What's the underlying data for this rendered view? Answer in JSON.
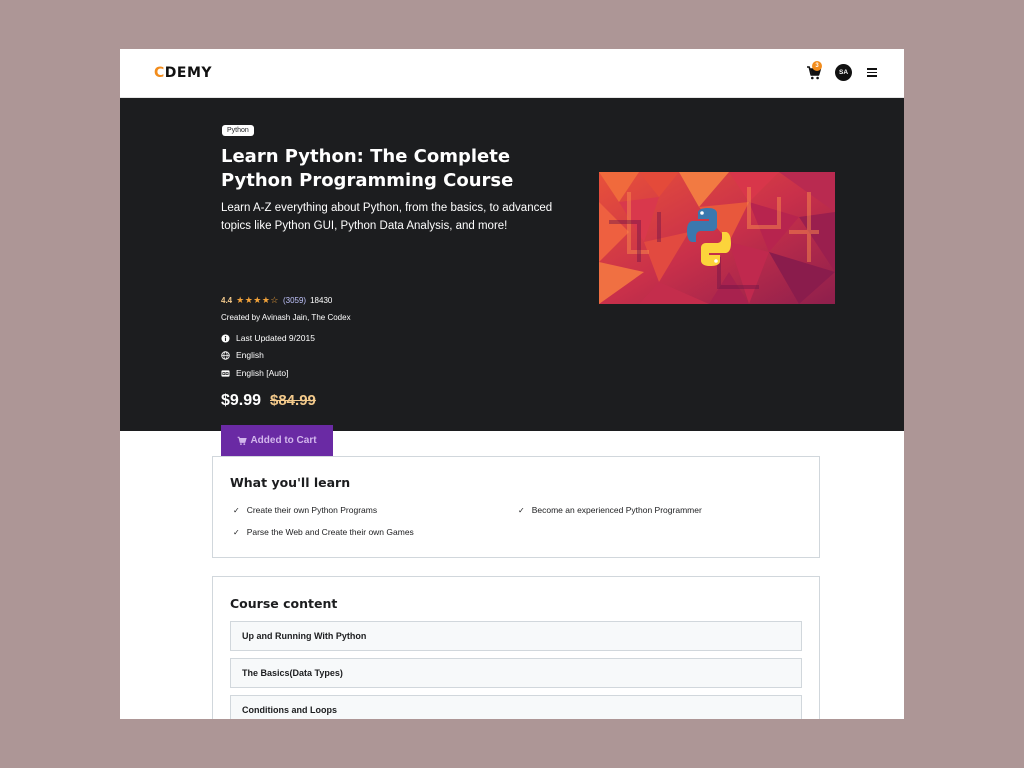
{
  "header": {
    "logo_first": "C",
    "logo_rest": "DEMY",
    "cart_count": "3",
    "avatar_initials": "SA"
  },
  "hero": {
    "tag": "Python",
    "title": "Learn Python: The Complete Python Programming Course",
    "subtitle": "Learn A-Z everything about Python, from the basics, to advanced topics like Python GUI, Python Data Analysis, and more!",
    "rating": "4.4",
    "stars": "★★★★☆",
    "reviews": "(3059)",
    "students": "18430",
    "created_by": "Created by Avinash Jain, The Codex",
    "last_updated": "Last Updated 9/2015",
    "language": "English",
    "captions": "English [Auto]",
    "price": "$9.99",
    "old_price": "$84.99",
    "cart_button": "Added to Cart"
  },
  "learn": {
    "title": "What you'll learn",
    "items": [
      "Create their own Python Programs",
      "Become an experienced Python Programmer",
      "Parse the Web and Create their own Games"
    ]
  },
  "content": {
    "title": "Course content",
    "sections": [
      "Up and Running With Python",
      "The Basics(Data Types)",
      "Conditions and Loops"
    ]
  },
  "colors": {
    "page_bg": "#ad9696",
    "hero_bg": "#1c1d1f",
    "accent_orange": "#f28c1c",
    "button_purple": "#6a2aa4",
    "old_price": "#f3ca8c",
    "stars": "#f3a33a"
  },
  "icons": [
    "cart-icon",
    "menu-icon",
    "info-icon",
    "globe-icon",
    "captions-icon",
    "check-icon",
    "python-logo"
  ]
}
